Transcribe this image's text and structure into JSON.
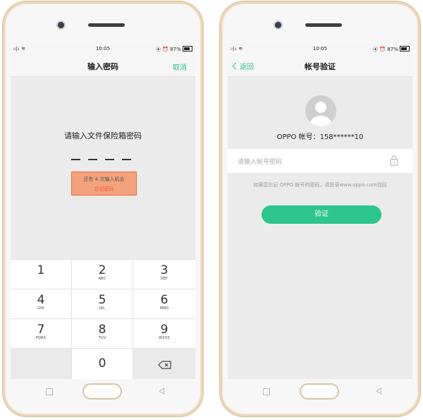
{
  "status": {
    "signal": "ᵢₗ|ᵢₗ ≋",
    "time": "10:05",
    "battery": "87%",
    "alarm_icons": "⦿ ⏰"
  },
  "left": {
    "title": "输入密码",
    "cancel": "取消",
    "prompt": "请输入文件保险箱密码",
    "attempts": "还有 4 次输入机会",
    "forgot": "忘记密码",
    "keys": [
      {
        "num": "1",
        "sub": ""
      },
      {
        "num": "2",
        "sub": "ABC"
      },
      {
        "num": "3",
        "sub": "DEF"
      },
      {
        "num": "4",
        "sub": "GHI"
      },
      {
        "num": "5",
        "sub": "JKL"
      },
      {
        "num": "6",
        "sub": "MNO"
      },
      {
        "num": "7",
        "sub": "PQRS"
      },
      {
        "num": "8",
        "sub": "TUV"
      },
      {
        "num": "9",
        "sub": "WXYZ"
      },
      {
        "num": "0",
        "sub": ""
      }
    ]
  },
  "right": {
    "back": "返回",
    "title": "帐号验证",
    "account": "OPPO 帐号：158******10",
    "password_placeholder": "请输入帐号密码",
    "hint": "如果您忘记 OPPO 帐号的密码，请登录www.oppo.com找回",
    "verify": "验证"
  },
  "colors": {
    "accent": "#2bbf8c",
    "warn_border": "#ee6a3e",
    "warn_fill": "#f2a37c",
    "frame": "#e9d6b8"
  }
}
